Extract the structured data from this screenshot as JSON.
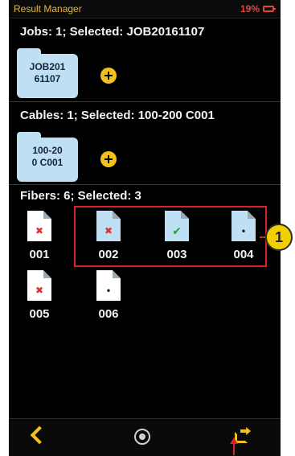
{
  "status_bar": {
    "app_title": "Result Manager",
    "battery": "19%"
  },
  "jobs": {
    "label": "Jobs: 1; Selected: JOB20161107",
    "folder_label": "JOB201\n61107"
  },
  "cables": {
    "label": "Cables: 1; Selected: 100-200 C001",
    "folder_label": "100-20\n0 C001"
  },
  "fibers": {
    "label": "Fibers: 6; Selected: 3",
    "items": [
      {
        "number": "001",
        "status": "fail",
        "selected": false
      },
      {
        "number": "002",
        "status": "fail",
        "selected": true
      },
      {
        "number": "003",
        "status": "pass",
        "selected": true
      },
      {
        "number": "004",
        "status": "none",
        "selected": true
      },
      {
        "number": "005",
        "status": "fail",
        "selected": false
      },
      {
        "number": "006",
        "status": "none",
        "selected": false
      }
    ]
  },
  "callout": {
    "number": "1"
  },
  "colors": {
    "accent": "#f2c21b",
    "selected_fill": "#bfe0f2",
    "fail": "#e03030",
    "pass": "#1fa33a",
    "highlight_box": "#d8232a"
  },
  "icons": {
    "back": "chevron-left-icon",
    "home": "home-circle-icon",
    "export": "share-export-icon"
  }
}
